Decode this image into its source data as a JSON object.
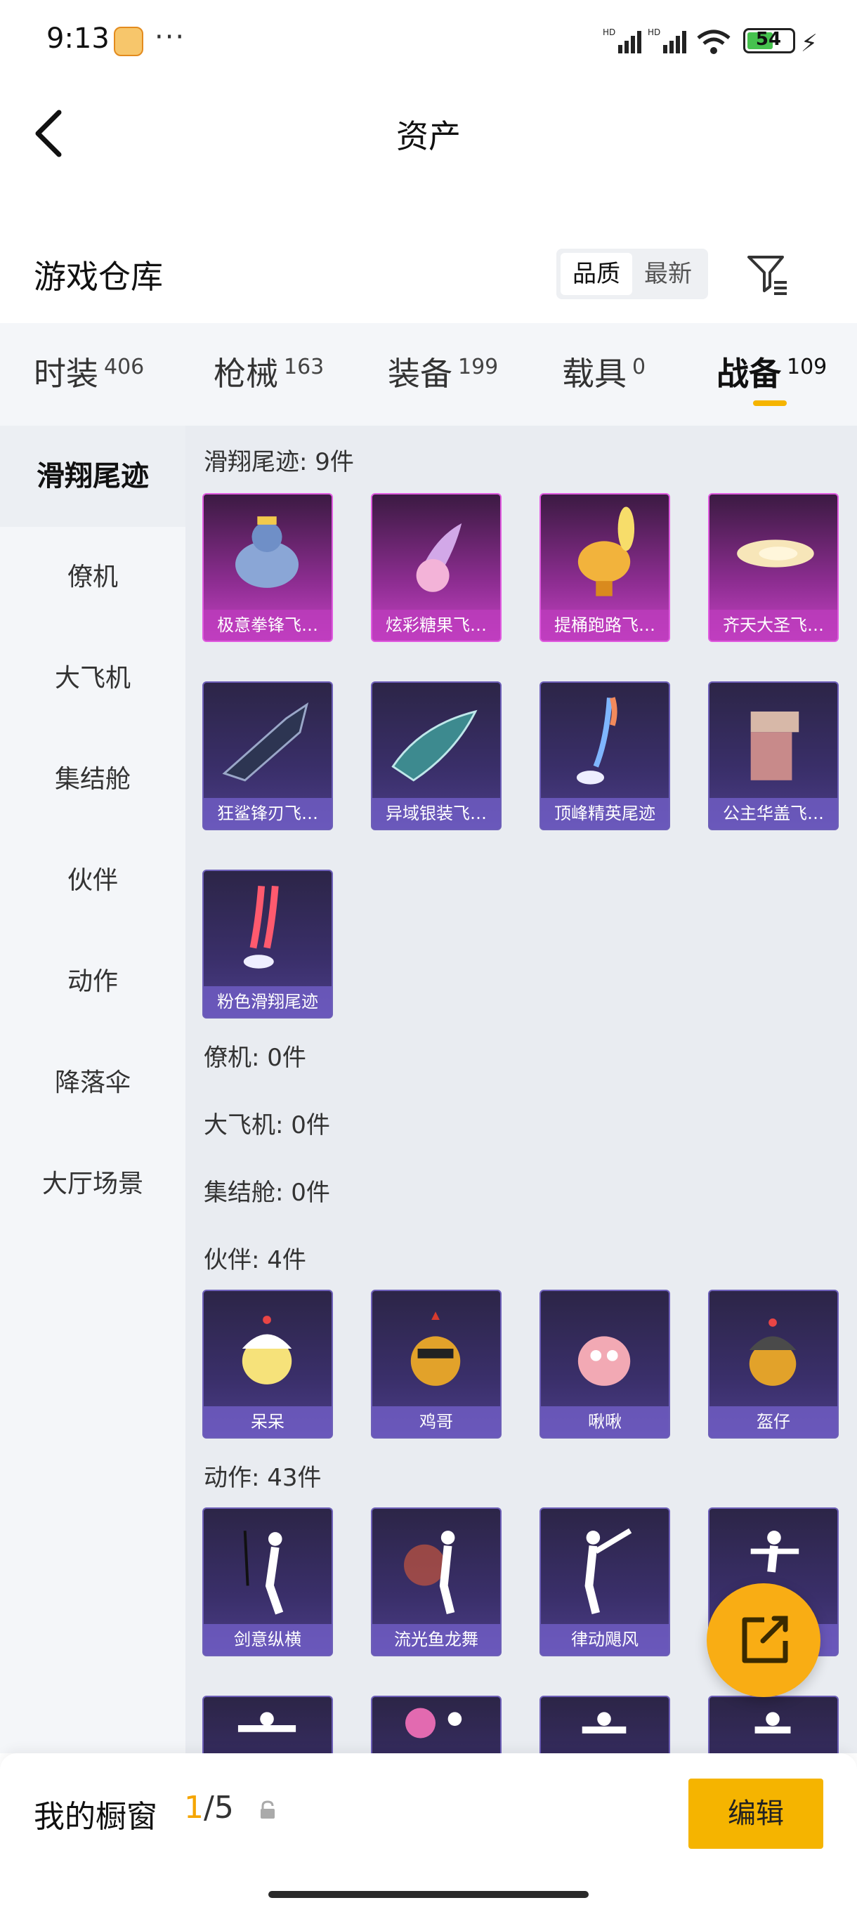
{
  "status_bar": {
    "time": "9:13",
    "more": "···",
    "battery": "54",
    "signal_labels": [
      "HD",
      "HD"
    ]
  },
  "nav": {
    "title": "资产",
    "back_icon": "chevron-left-icon"
  },
  "section": {
    "title": "游戏仓库",
    "sort_options": [
      "品质",
      "最新"
    ],
    "sort_active": "品质",
    "filter_icon": "filter-icon"
  },
  "tabs": [
    {
      "label": "时装",
      "count": "406"
    },
    {
      "label": "枪械",
      "count": "163"
    },
    {
      "label": "装备",
      "count": "199"
    },
    {
      "label": "载具",
      "count": "0"
    },
    {
      "label": "战备",
      "count": "109"
    }
  ],
  "active_tab": "战备",
  "sidebar": {
    "items": [
      "滑翔尾迹",
      "僚机",
      "大飞机",
      "集结舱",
      "伙伴",
      "动作",
      "降落伞",
      "大厅场景"
    ],
    "active": "滑翔尾迹"
  },
  "groups": {
    "glide": {
      "title": "滑翔尾迹: 9件",
      "items": [
        "极意拳锋飞…",
        "炫彩糖果飞…",
        "提桶跑路飞…",
        "齐天大圣飞…",
        "狂鲨锋刃飞…",
        "异域银装飞…",
        "顶峰精英尾迹",
        "公主华盖飞…",
        "粉色滑翔尾迹"
      ]
    },
    "wingman": {
      "title": "僚机: 0件"
    },
    "plane": {
      "title": "大飞机: 0件"
    },
    "pod": {
      "title": "集结舱: 0件"
    },
    "partner": {
      "title": "伙伴: 4件",
      "items": [
        "呆呆",
        "鸡哥",
        "啾啾",
        "盔仔"
      ]
    },
    "emote": {
      "title": "动作: 43件",
      "items": [
        "剑意纵横",
        "流光鱼龙舞",
        "律动飓风",
        ""
      ]
    }
  },
  "colors": {
    "accent": "#f5b400",
    "fab": "#f9ad14",
    "card_purple": "#3a2f6a",
    "card_pink": "#c643c4"
  },
  "fab_icon": "share-external-icon",
  "bottom_bar": {
    "label": "我的橱窗",
    "current": "1",
    "separator": "/",
    "total": "5",
    "lock_icon": "lock-icon",
    "edit_label": "编辑"
  }
}
